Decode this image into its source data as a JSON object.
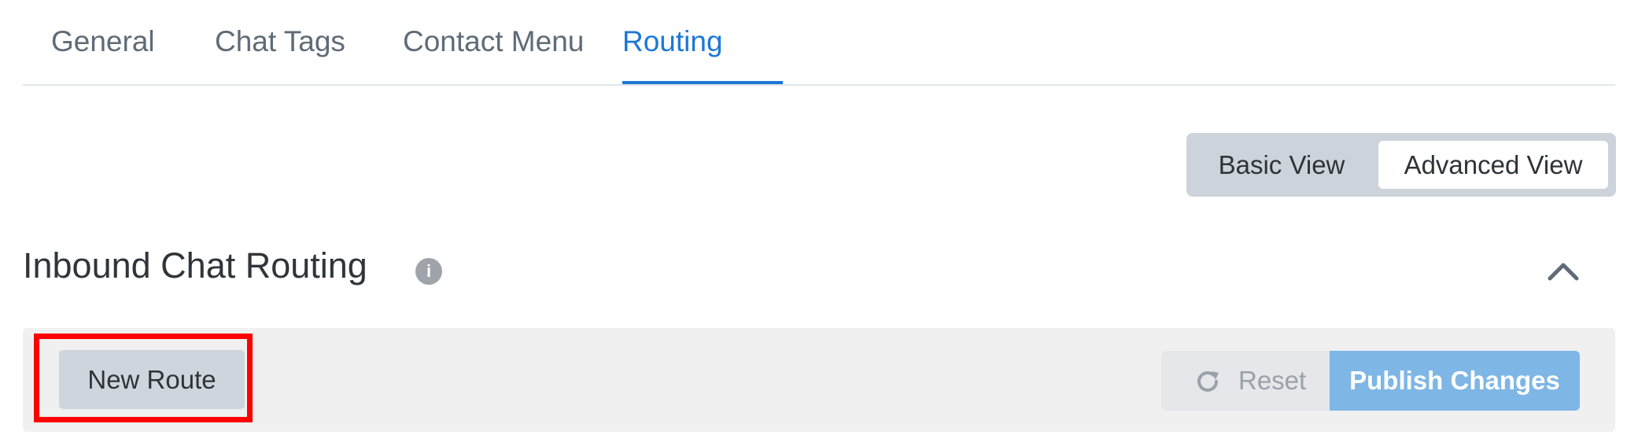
{
  "tabs": {
    "items": [
      {
        "label": "General"
      },
      {
        "label": "Chat Tags"
      },
      {
        "label": "Contact Menu"
      },
      {
        "label": "Routing"
      }
    ],
    "active": "Routing"
  },
  "view_toggle": {
    "options": [
      "Basic View",
      "Advanced View"
    ],
    "selected": "Advanced View"
  },
  "section": {
    "title": "Inbound Chat Routing",
    "info_icon": "info-icon",
    "collapse_icon": "chevron-up-icon"
  },
  "actions": {
    "new_route_label": "New Route",
    "reset_label": "Reset",
    "reset_icon": "refresh-icon",
    "publish_label": "Publish Changes"
  },
  "colors": {
    "accent": "#1d78d6",
    "highlight": "#ff0000",
    "publish_bg": "#7eb6e6",
    "toggle_bg": "#cdd3da"
  }
}
